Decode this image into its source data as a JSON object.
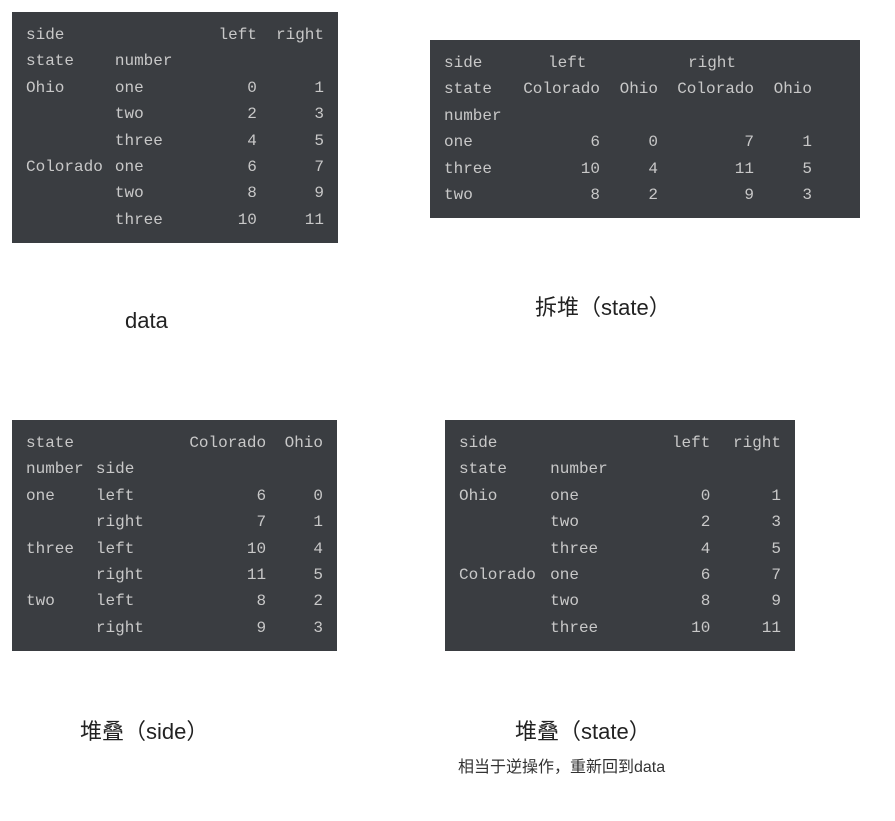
{
  "captions": {
    "c1": "data",
    "c2": "拆堆（state）",
    "c3": "堆叠（side）",
    "c4": "堆叠（state）",
    "sub4": "相当于逆操作，重新回到data"
  },
  "labels": {
    "side": "side",
    "state": "state",
    "number": "number",
    "left": "left",
    "right": "right",
    "Ohio": "Ohio",
    "Colorado": "Colorado",
    "one": "one",
    "two": "two",
    "three": "three"
  },
  "p1": {
    "r0": {
      "v2": "0",
      "v3": "1"
    },
    "r1": {
      "v2": "2",
      "v3": "3"
    },
    "r2": {
      "v2": "4",
      "v3": "5"
    },
    "r3": {
      "v2": "6",
      "v3": "7"
    },
    "r4": {
      "v2": "8",
      "v3": "9"
    },
    "r5": {
      "v2": "10",
      "v3": "11"
    }
  },
  "p2": {
    "r0": {
      "v1": "6",
      "v2": "0",
      "v3": "7",
      "v4": "1"
    },
    "r1": {
      "v1": "10",
      "v2": "4",
      "v3": "11",
      "v4": "5"
    },
    "r2": {
      "v1": "8",
      "v2": "2",
      "v3": "9",
      "v4": "3"
    }
  },
  "p3": {
    "r0": {
      "v2": "6",
      "v3": "0"
    },
    "r1": {
      "v2": "7",
      "v3": "1"
    },
    "r2": {
      "v2": "10",
      "v3": "4"
    },
    "r3": {
      "v2": "11",
      "v3": "5"
    },
    "r4": {
      "v2": "8",
      "v3": "2"
    },
    "r5": {
      "v2": "9",
      "v3": "3"
    }
  },
  "p4": {
    "r0": {
      "v2": "0",
      "v3": "1"
    },
    "r1": {
      "v2": "2",
      "v3": "3"
    },
    "r2": {
      "v2": "4",
      "v3": "5"
    },
    "r3": {
      "v2": "6",
      "v3": "7"
    },
    "r4": {
      "v2": "8",
      "v3": "9"
    },
    "r5": {
      "v2": "10",
      "v3": "11"
    }
  }
}
